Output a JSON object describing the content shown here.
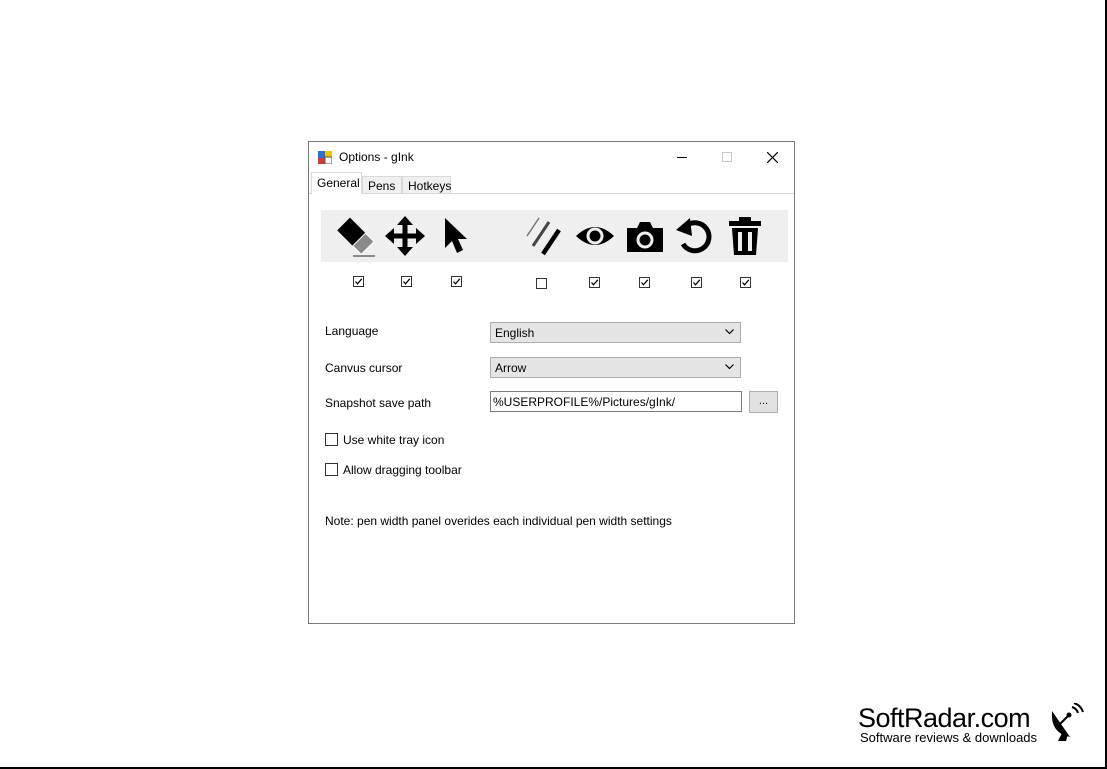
{
  "window": {
    "title": "Options - gInk",
    "controls": {
      "minimize": "minimize-icon",
      "maximize": "maximize-icon",
      "close": "close-icon"
    }
  },
  "tabs": [
    {
      "label": "General",
      "active": true
    },
    {
      "label": "Pens",
      "active": false
    },
    {
      "label": "Hotkeys",
      "active": false
    }
  ],
  "toolbar_icons": [
    {
      "icon": "eraser-icon",
      "checked": true
    },
    {
      "icon": "move-icon",
      "checked": true
    },
    {
      "icon": "pointer-icon",
      "checked": true
    },
    {
      "icon": "pen-width-icon",
      "checked": false
    },
    {
      "icon": "eye-icon",
      "checked": true
    },
    {
      "icon": "camera-icon",
      "checked": true
    },
    {
      "icon": "undo-icon",
      "checked": true
    },
    {
      "icon": "trash-icon",
      "checked": true
    }
  ],
  "form": {
    "language_label": "Language",
    "language_value": "English",
    "cursor_label": "Canvus cursor",
    "cursor_value": "Arrow",
    "snapshot_label": "Snapshot save path",
    "snapshot_value": "%USERPROFILE%/Pictures/gInk/",
    "browse_label": "...",
    "white_tray_label": "Use white tray icon",
    "white_tray_checked": false,
    "dragging_label": "Allow dragging toolbar",
    "dragging_checked": false,
    "note": "Note: pen width panel overides each individual pen width settings"
  },
  "branding": {
    "name": "SoftRadar.com",
    "tagline": "Software reviews & downloads"
  }
}
